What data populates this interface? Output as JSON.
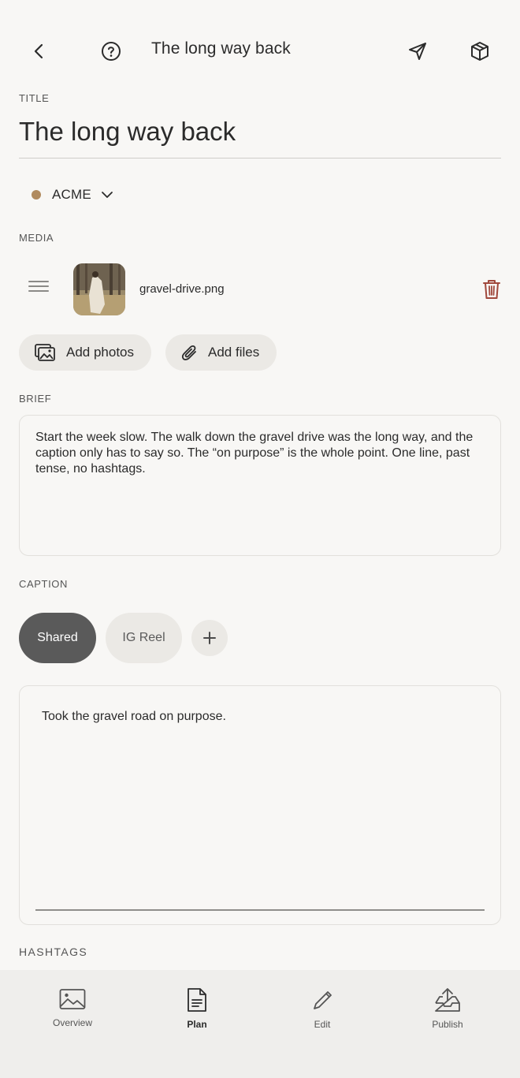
{
  "header": {
    "title": "The long way back",
    "icons": [
      "back-chevron-icon",
      "help-circle-icon",
      "send-icon",
      "package-icon"
    ]
  },
  "title_section": {
    "label": "TITLE",
    "value": "The long way back"
  },
  "brand": {
    "name": "ACME",
    "dot_color": "#b08a5e"
  },
  "media": {
    "label": "MEDIA",
    "items": [
      {
        "filename": "gravel-drive.png"
      }
    ],
    "add_photos_label": "Add photos",
    "add_files_label": "Add files"
  },
  "brief": {
    "label": "BRIEF",
    "text": "Start the week slow. The walk down the gravel drive was the long way, and the caption only has to say so. The “on purpose” is the whole point. One line, past tense, no hashtags."
  },
  "caption": {
    "label": "CAPTION",
    "tabs": [
      {
        "label": "Shared",
        "active": true
      },
      {
        "label": "IG Reel",
        "active": false
      }
    ],
    "text": "Took the gravel road on purpose."
  },
  "hashtags": {
    "label": "HASHTAGS"
  },
  "bottom_nav": {
    "items": [
      {
        "label": "Overview",
        "icon": "image-icon",
        "active": false
      },
      {
        "label": "Plan",
        "icon": "document-icon",
        "active": true
      },
      {
        "label": "Edit",
        "icon": "pencil-icon",
        "active": false
      },
      {
        "label": "Publish",
        "icon": "inbox-upload-icon",
        "active": false
      }
    ]
  },
  "colors": {
    "background": "#f8f7f5",
    "active_chip": "#5a5a5a",
    "delete": "#a0483c",
    "nav_background": "#efeeec"
  }
}
